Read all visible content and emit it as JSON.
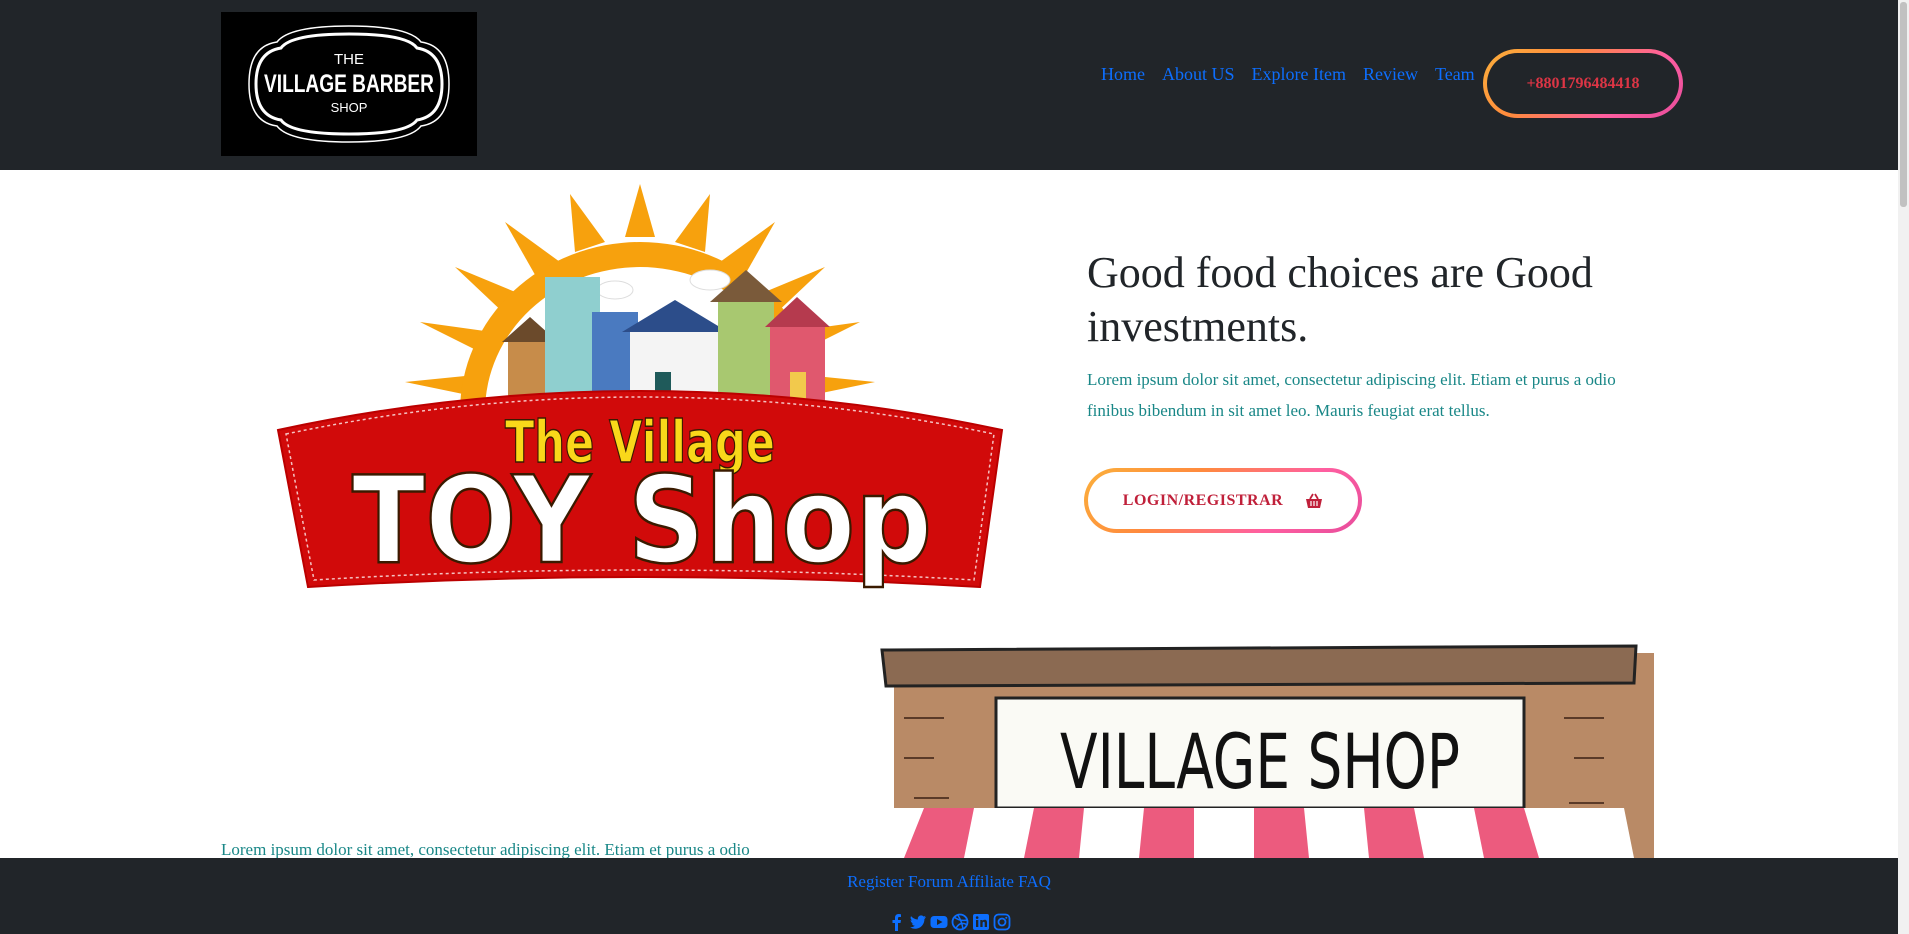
{
  "header": {
    "logo_alt": "The Village Barber Shop",
    "logo_lines": [
      "THE",
      "VILLAGE BARBER",
      "SHOP"
    ],
    "nav": [
      "Home",
      "About US",
      "Explore Item",
      "Review",
      "Team"
    ],
    "phone": "+8801796484418"
  },
  "hero": {
    "image_lines": [
      "The Village",
      "TOY Shop"
    ],
    "title": "Good food choices are Good investments.",
    "text": "Lorem ipsum dolor sit amet, consectetur adipiscing elit. Etiam et purus a odio finibus bibendum in sit amet leo. Mauris feugiat erat tellus.",
    "login_label": "LOGIN/REGISTRAR"
  },
  "section2": {
    "image_sign": "VILLAGE SHOP",
    "text": "Lorem ipsum dolor sit amet, consectetur adipiscing elit. Etiam et purus a odio"
  },
  "footer": {
    "links": [
      "Register",
      "Forum",
      "Affiliate",
      "FAQ"
    ],
    "socials": [
      "facebook-icon",
      "twitter-icon",
      "youtube-icon",
      "dribbble-icon",
      "linkedin-icon",
      "instagram-icon"
    ]
  },
  "colors": {
    "header_bg": "#212529",
    "link": "#0d6efd",
    "accent_red": "#dc3545",
    "text_teal": "#198787",
    "gradient_start": "#fbb03b",
    "gradient_end": "#e74c9c"
  }
}
